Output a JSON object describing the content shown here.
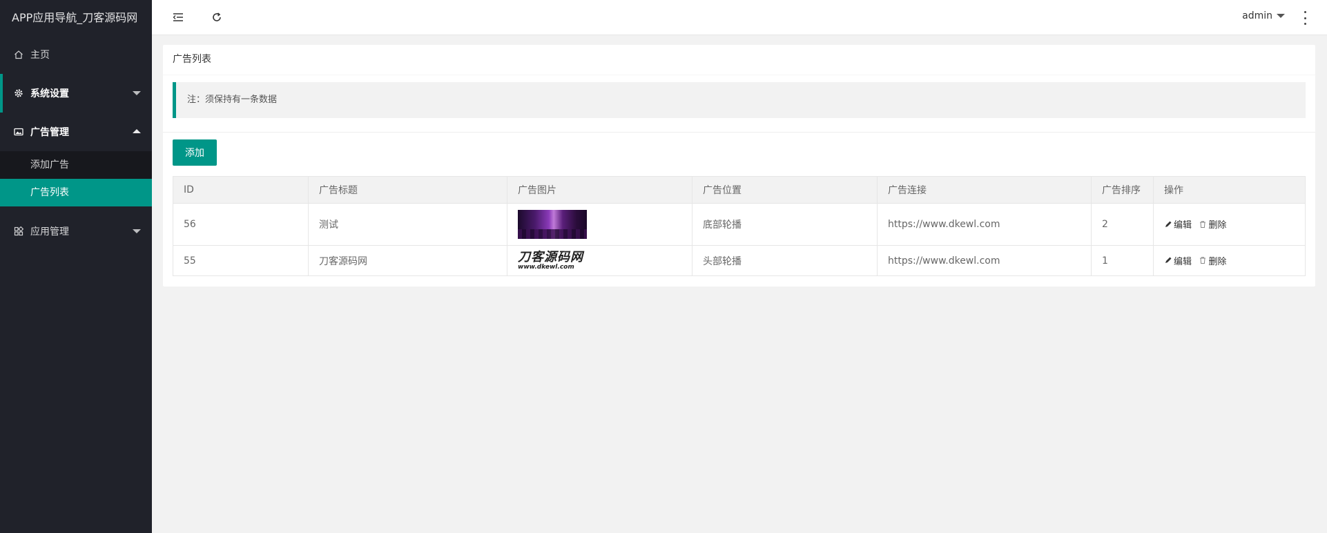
{
  "app": {
    "title": "APP应用导航_刀客源码网"
  },
  "sidebar": {
    "home": {
      "label": "主页",
      "icon": "home-icon"
    },
    "system": {
      "label": "系统设置",
      "icon": "gear-icon"
    },
    "ads": {
      "label": "广告管理",
      "icon": "image-icon",
      "children": [
        {
          "label": "添加广告"
        },
        {
          "label": "广告列表"
        }
      ]
    },
    "apps": {
      "label": "应用管理",
      "icon": "apps-icon"
    }
  },
  "header": {
    "user": "admin"
  },
  "card": {
    "title": "广告列表",
    "note": "注：须保持有一条数据",
    "add_label": "添加"
  },
  "table": {
    "columns": [
      "ID",
      "广告标题",
      "广告图片",
      "广告位置",
      "广告连接",
      "广告排序",
      "操作"
    ],
    "rows": [
      {
        "id": "56",
        "title": "测试",
        "position": "底部轮播",
        "url": "https://www.dkewl.com",
        "order": "2"
      },
      {
        "id": "55",
        "title": "刀客源码网",
        "position": "头部轮播",
        "url": "https://www.dkewl.com",
        "order": "1"
      }
    ],
    "edit_label": "编辑",
    "delete_label": "删除"
  },
  "logo_image": {
    "text": "刀客源码网",
    "subtext": "www.dkewl.com"
  },
  "colors": {
    "accent": "#009688",
    "sidebar_bg": "#20222a",
    "submenu_bg": "#17181d"
  }
}
